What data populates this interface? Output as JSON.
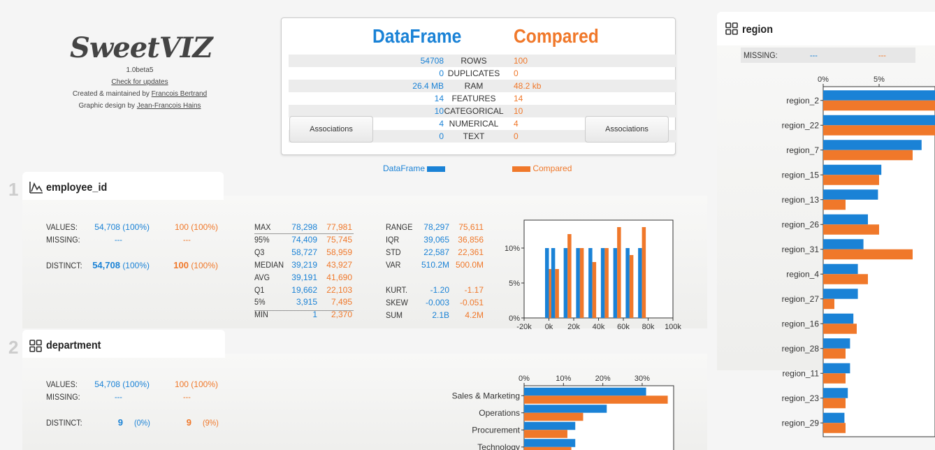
{
  "logo": {
    "brand": "SweetVIZ",
    "version": "1.0beta5",
    "check_updates": "Check for updates",
    "created_prefix": "Created & maintained by ",
    "created_name": "Francois Bertrand",
    "design_prefix": "Graphic design by ",
    "design_name": "Jean-Francois Hains"
  },
  "summary": {
    "left_header": "DataFrame",
    "right_header": "Compared",
    "rows": [
      {
        "label": "ROWS",
        "left": "54708",
        "right": "100"
      },
      {
        "label": "DUPLICATES",
        "left": "0",
        "right": "0"
      },
      {
        "label": "RAM",
        "left": "26.4 MB",
        "right": "48.2 kb"
      },
      {
        "label": "FEATURES",
        "left": "14",
        "right": "14"
      },
      {
        "label": "CATEGORICAL",
        "left": "10",
        "right": "10"
      },
      {
        "label": "NUMERICAL",
        "left": "4",
        "right": "4"
      },
      {
        "label": "TEXT",
        "left": "0",
        "right": "0"
      }
    ],
    "assoc_left": "Associations",
    "assoc_right": "Associations",
    "legend_left": "DataFrame",
    "legend_right": "Compared"
  },
  "colors": {
    "source": "#1a82d6",
    "compare": "#f0782a"
  },
  "employee": {
    "index": "1",
    "icon": "numeric-distribution-icon",
    "name": "employee_id",
    "values_label": "VALUES:",
    "values_left": "54,708 (100%)",
    "values_right": "100 (100%)",
    "missing_label": "MISSING:",
    "missing_left": "---",
    "missing_right": "---",
    "distinct_label": "DISTINCT:",
    "distinct_left_num": "54,708",
    "distinct_left_pct": "(100%)",
    "distinct_right_num": "100",
    "distinct_right_pct": "(100%)",
    "quantiles": [
      {
        "label": "MAX",
        "a": "78,298",
        "b": "77,981"
      },
      {
        "label": "95%",
        "a": "74,409",
        "b": "75,745"
      },
      {
        "label": "Q3",
        "a": "58,727",
        "b": "58,959"
      },
      {
        "label": "MEDIAN",
        "a": "39,219",
        "b": "43,927"
      },
      {
        "label": "AVG",
        "a": "39,191",
        "b": "41,690"
      },
      {
        "label": "Q1",
        "a": "19,662",
        "b": "22,103"
      },
      {
        "label": "5%",
        "a": "3,915",
        "b": "7,495"
      },
      {
        "label": "MIN",
        "a": "1",
        "b": "2,370"
      }
    ],
    "stats": [
      {
        "label": "RANGE",
        "a": "78,297",
        "b": "75,611"
      },
      {
        "label": "IQR",
        "a": "39,065",
        "b": "36,856"
      },
      {
        "label": "STD",
        "a": "22,587",
        "b": "22,361"
      },
      {
        "label": "VAR",
        "a": "510.2M",
        "b": "500.0M"
      }
    ],
    "moments": [
      {
        "label": "KURT.",
        "a": "-1.20",
        "b": "-1.17"
      },
      {
        "label": "SKEW",
        "a": "-0.003",
        "b": "-0.051"
      },
      {
        "label": "SUM",
        "a": "2.1B",
        "b": "4.2M"
      }
    ]
  },
  "department": {
    "index": "2",
    "icon": "categorical-grid-icon",
    "name": "department",
    "values_label": "VALUES:",
    "values_left": "54,708 (100%)",
    "values_right": "100 (100%)",
    "missing_label": "MISSING:",
    "missing_left": "---",
    "missing_right": "---",
    "distinct_label": "DISTINCT:",
    "distinct_left_num": "9",
    "distinct_left_pct": "(0%)",
    "distinct_right_num": "9",
    "distinct_right_pct": "(9%)"
  },
  "region": {
    "icon": "categorical-grid-icon",
    "name": "region",
    "missing_label": "MISSING:",
    "missing_left": "---",
    "missing_right": "---"
  },
  "chart_data": [
    {
      "type": "bar",
      "x": [
        0,
        5000,
        15000,
        25000,
        35000,
        45000,
        55000,
        65000,
        75000
      ],
      "xticks": [
        "-20k",
        "0k",
        "20k",
        "40k",
        "60k",
        "80k",
        "100k"
      ],
      "xlim": [
        -20000,
        100000
      ],
      "yticks": [
        "0%",
        "5%",
        "10%"
      ],
      "ylim": [
        0,
        14
      ],
      "series": [
        {
          "values": [
            10,
            10,
            10,
            10,
            10,
            10,
            10,
            10,
            10
          ]
        },
        {
          "values": [
            7,
            7,
            12,
            10,
            8,
            10,
            13,
            9,
            13
          ]
        }
      ]
    },
    {
      "type": "bar",
      "orientation": "horizontal",
      "categories": [
        "Sales & Marketing",
        "Operations",
        "Procurement",
        "Technology"
      ],
      "xticks": [
        "0%",
        "10%",
        "20%",
        "30%"
      ],
      "xlim": [
        0,
        38
      ],
      "series": [
        {
          "values": [
            31,
            21,
            13,
            13
          ]
        },
        {
          "values": [
            36.5,
            15,
            11,
            12
          ]
        }
      ]
    },
    {
      "type": "bar",
      "orientation": "horizontal",
      "categories": [
        "region_2",
        "region_22",
        "region_7",
        "region_15",
        "region_13",
        "region_26",
        "region_31",
        "region_4",
        "region_27",
        "region_16",
        "region_28",
        "region_11",
        "region_23",
        "region_29"
      ],
      "xticks": [
        "0%",
        "5%"
      ],
      "xlim": [
        0,
        10
      ],
      "series": [
        {
          "values": [
            23,
            12,
            8.8,
            5.2,
            4.9,
            4,
            3.6,
            3.1,
            3.1,
            2.7,
            2.4,
            2.4,
            2.2,
            1.9
          ]
        },
        {
          "values": [
            22,
            11,
            8,
            5,
            2,
            5,
            8,
            4,
            1,
            3,
            2,
            2,
            2,
            2
          ]
        }
      ]
    }
  ]
}
